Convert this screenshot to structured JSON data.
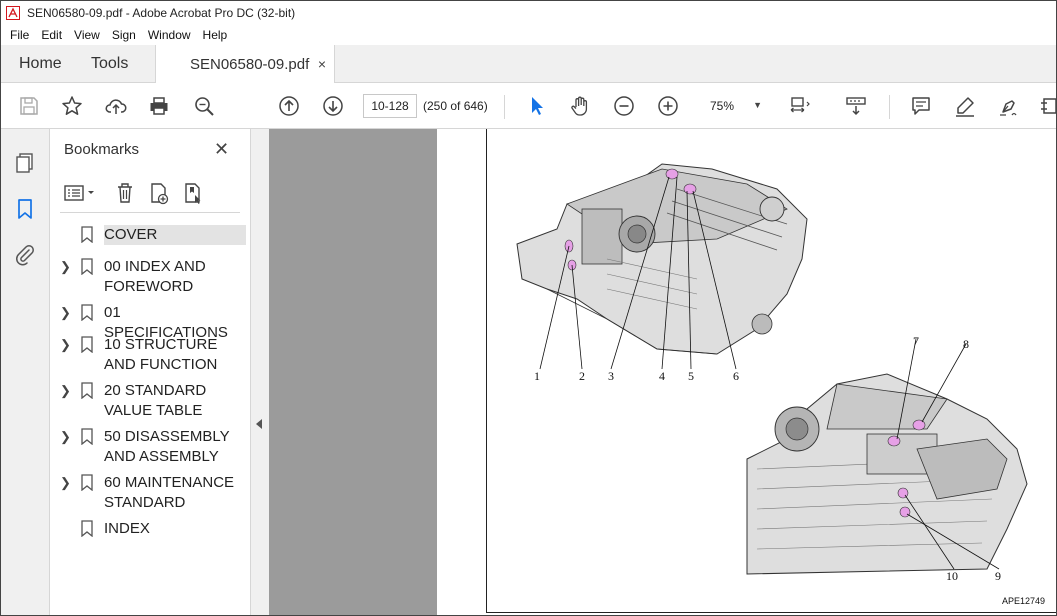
{
  "window": {
    "title": "SEN06580-09.pdf - Adobe Acrobat Pro DC (32-bit)"
  },
  "menu": [
    "File",
    "Edit",
    "View",
    "Sign",
    "Window",
    "Help"
  ],
  "tabs": {
    "home": "Home",
    "tools": "Tools",
    "doc": "SEN06580-09.pdf",
    "close": "×"
  },
  "toolbar": {
    "page_value": "10-128",
    "page_of": "(250 of 646)",
    "zoom": "75%"
  },
  "bookmarks": {
    "title": "Bookmarks",
    "close": "✕",
    "items": [
      {
        "label": "COVER",
        "expandable": false,
        "selected": true
      },
      {
        "label": " 00 INDEX AND FOREWORD",
        "expandable": true
      },
      {
        "label": " 01 SPECIFICATIONS",
        "expandable": true
      },
      {
        "label": " 10 STRUCTURE AND FUNCTION",
        "expandable": true
      },
      {
        "label": " 20 STANDARD VALUE TABLE",
        "expandable": true
      },
      {
        "label": " 50 DISASSEMBLY AND ASSEMBLY",
        "expandable": true
      },
      {
        "label": " 60 MAINTENANCE STANDARD",
        "expandable": true
      },
      {
        "label": "INDEX",
        "expandable": false
      }
    ]
  },
  "figure": {
    "callouts": [
      "1",
      "2",
      "3",
      "4",
      "5",
      "6",
      "7",
      "8",
      "9",
      "10"
    ],
    "code": "APE12749"
  },
  "colors": {
    "acrobat_red": "#d4171e",
    "selection_blue": "#1473e6",
    "highlight_pink": "#e6a0e6"
  }
}
